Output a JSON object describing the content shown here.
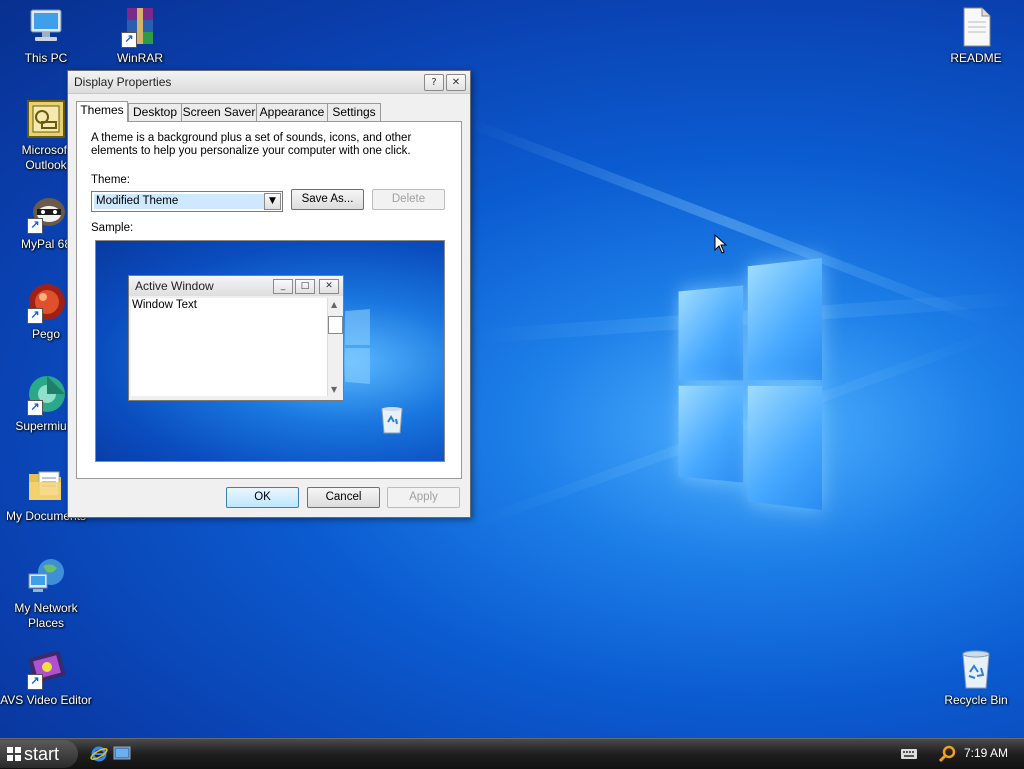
{
  "desktop": {
    "icons": [
      {
        "label": "This PC",
        "icon": "computer-icon"
      },
      {
        "label": "WinRAR",
        "icon": "winrar-icon"
      },
      {
        "label": "Microsoft Outlook",
        "icon": "outlook-icon"
      },
      {
        "label": "MyPal 68",
        "icon": "mypal-icon"
      },
      {
        "label": "Pego",
        "icon": "pego-icon"
      },
      {
        "label": "Supermium",
        "icon": "supermium-icon"
      },
      {
        "label": "My Documents",
        "icon": "folder-icon"
      },
      {
        "label": "My Network Places",
        "icon": "network-icon"
      },
      {
        "label": "AVS Video Editor",
        "icon": "video-editor-icon"
      },
      {
        "label": "README",
        "icon": "text-file-icon"
      },
      {
        "label": "Recycle Bin",
        "icon": "recycle-bin-icon"
      }
    ]
  },
  "dialog": {
    "title": "Display Properties",
    "help_button": "?",
    "close_button": "✕",
    "tabs": [
      "Themes",
      "Desktop",
      "Screen Saver",
      "Appearance",
      "Settings"
    ],
    "active_tab": "Themes",
    "description": "A theme is a background plus a set of sounds, icons, and other elements to help you personalize your computer with one click.",
    "theme_label": "Theme:",
    "theme_value": "Modified Theme",
    "save_as": "Save As...",
    "delete": "Delete",
    "sample_label": "Sample:",
    "sample": {
      "window_title": "Active Window",
      "window_text": "Window Text"
    },
    "ok": "OK",
    "cancel": "Cancel",
    "apply": "Apply"
  },
  "taskbar": {
    "start_label": "start",
    "time": "7:19 AM"
  },
  "colors": {
    "desktop_blue": "#0b5bd0",
    "taskbar": "#1e1e1e",
    "selection": "#cde8ff"
  }
}
